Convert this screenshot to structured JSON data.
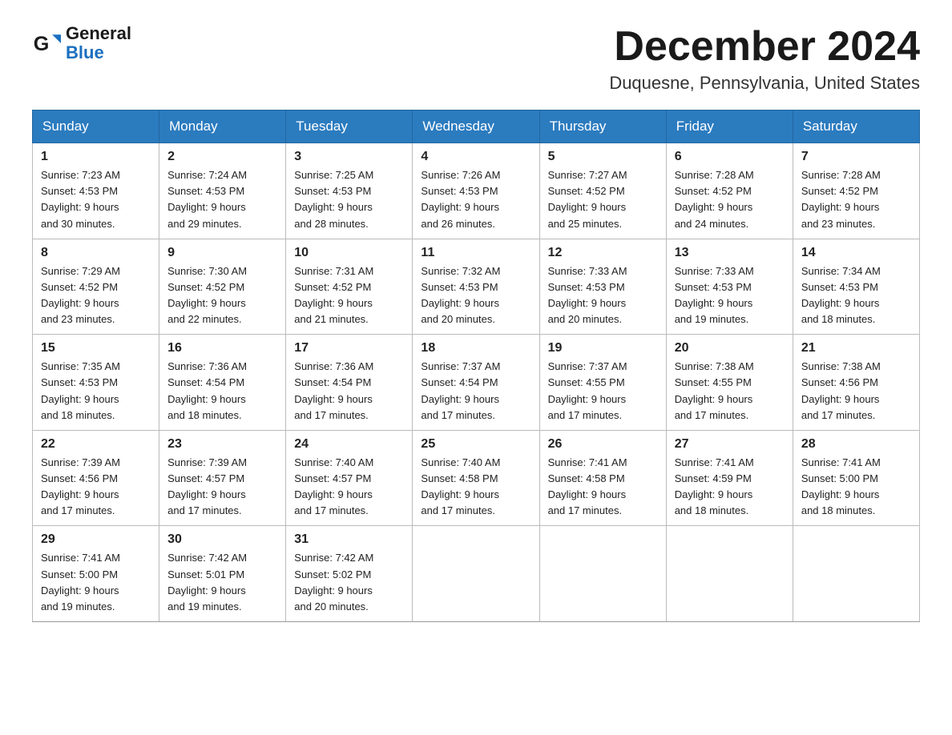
{
  "header": {
    "logo_general": "General",
    "logo_blue": "Blue",
    "month_title": "December 2024",
    "location": "Duquesne, Pennsylvania, United States"
  },
  "weekdays": [
    "Sunday",
    "Monday",
    "Tuesday",
    "Wednesday",
    "Thursday",
    "Friday",
    "Saturday"
  ],
  "weeks": [
    [
      {
        "day": "1",
        "sunrise": "7:23 AM",
        "sunset": "4:53 PM",
        "daylight": "9 hours and 30 minutes."
      },
      {
        "day": "2",
        "sunrise": "7:24 AM",
        "sunset": "4:53 PM",
        "daylight": "9 hours and 29 minutes."
      },
      {
        "day": "3",
        "sunrise": "7:25 AM",
        "sunset": "4:53 PM",
        "daylight": "9 hours and 28 minutes."
      },
      {
        "day": "4",
        "sunrise": "7:26 AM",
        "sunset": "4:53 PM",
        "daylight": "9 hours and 26 minutes."
      },
      {
        "day": "5",
        "sunrise": "7:27 AM",
        "sunset": "4:52 PM",
        "daylight": "9 hours and 25 minutes."
      },
      {
        "day": "6",
        "sunrise": "7:28 AM",
        "sunset": "4:52 PM",
        "daylight": "9 hours and 24 minutes."
      },
      {
        "day": "7",
        "sunrise": "7:28 AM",
        "sunset": "4:52 PM",
        "daylight": "9 hours and 23 minutes."
      }
    ],
    [
      {
        "day": "8",
        "sunrise": "7:29 AM",
        "sunset": "4:52 PM",
        "daylight": "9 hours and 23 minutes."
      },
      {
        "day": "9",
        "sunrise": "7:30 AM",
        "sunset": "4:52 PM",
        "daylight": "9 hours and 22 minutes."
      },
      {
        "day": "10",
        "sunrise": "7:31 AM",
        "sunset": "4:52 PM",
        "daylight": "9 hours and 21 minutes."
      },
      {
        "day": "11",
        "sunrise": "7:32 AM",
        "sunset": "4:53 PM",
        "daylight": "9 hours and 20 minutes."
      },
      {
        "day": "12",
        "sunrise": "7:33 AM",
        "sunset": "4:53 PM",
        "daylight": "9 hours and 20 minutes."
      },
      {
        "day": "13",
        "sunrise": "7:33 AM",
        "sunset": "4:53 PM",
        "daylight": "9 hours and 19 minutes."
      },
      {
        "day": "14",
        "sunrise": "7:34 AM",
        "sunset": "4:53 PM",
        "daylight": "9 hours and 18 minutes."
      }
    ],
    [
      {
        "day": "15",
        "sunrise": "7:35 AM",
        "sunset": "4:53 PM",
        "daylight": "9 hours and 18 minutes."
      },
      {
        "day": "16",
        "sunrise": "7:36 AM",
        "sunset": "4:54 PM",
        "daylight": "9 hours and 18 minutes."
      },
      {
        "day": "17",
        "sunrise": "7:36 AM",
        "sunset": "4:54 PM",
        "daylight": "9 hours and 17 minutes."
      },
      {
        "day": "18",
        "sunrise": "7:37 AM",
        "sunset": "4:54 PM",
        "daylight": "9 hours and 17 minutes."
      },
      {
        "day": "19",
        "sunrise": "7:37 AM",
        "sunset": "4:55 PM",
        "daylight": "9 hours and 17 minutes."
      },
      {
        "day": "20",
        "sunrise": "7:38 AM",
        "sunset": "4:55 PM",
        "daylight": "9 hours and 17 minutes."
      },
      {
        "day": "21",
        "sunrise": "7:38 AM",
        "sunset": "4:56 PM",
        "daylight": "9 hours and 17 minutes."
      }
    ],
    [
      {
        "day": "22",
        "sunrise": "7:39 AM",
        "sunset": "4:56 PM",
        "daylight": "9 hours and 17 minutes."
      },
      {
        "day": "23",
        "sunrise": "7:39 AM",
        "sunset": "4:57 PM",
        "daylight": "9 hours and 17 minutes."
      },
      {
        "day": "24",
        "sunrise": "7:40 AM",
        "sunset": "4:57 PM",
        "daylight": "9 hours and 17 minutes."
      },
      {
        "day": "25",
        "sunrise": "7:40 AM",
        "sunset": "4:58 PM",
        "daylight": "9 hours and 17 minutes."
      },
      {
        "day": "26",
        "sunrise": "7:41 AM",
        "sunset": "4:58 PM",
        "daylight": "9 hours and 17 minutes."
      },
      {
        "day": "27",
        "sunrise": "7:41 AM",
        "sunset": "4:59 PM",
        "daylight": "9 hours and 18 minutes."
      },
      {
        "day": "28",
        "sunrise": "7:41 AM",
        "sunset": "5:00 PM",
        "daylight": "9 hours and 18 minutes."
      }
    ],
    [
      {
        "day": "29",
        "sunrise": "7:41 AM",
        "sunset": "5:00 PM",
        "daylight": "9 hours and 19 minutes."
      },
      {
        "day": "30",
        "sunrise": "7:42 AM",
        "sunset": "5:01 PM",
        "daylight": "9 hours and 19 minutes."
      },
      {
        "day": "31",
        "sunrise": "7:42 AM",
        "sunset": "5:02 PM",
        "daylight": "9 hours and 20 minutes."
      },
      null,
      null,
      null,
      null
    ]
  ],
  "labels": {
    "sunrise": "Sunrise:",
    "sunset": "Sunset:",
    "daylight": "Daylight:"
  }
}
